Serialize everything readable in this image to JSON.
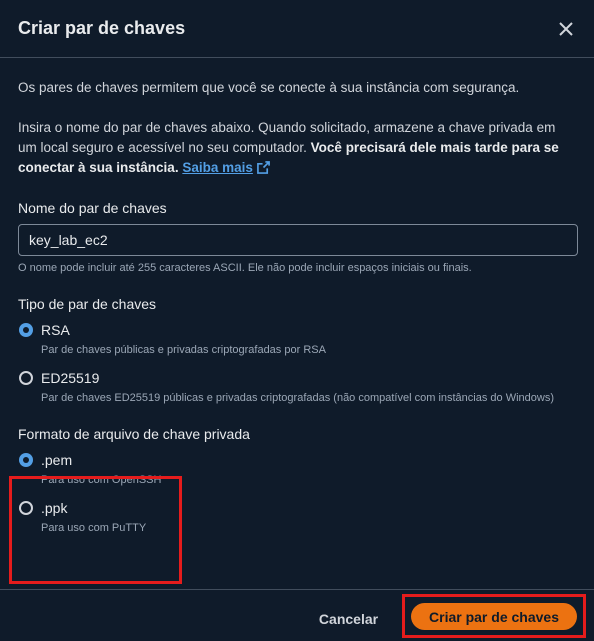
{
  "modal": {
    "title": "Criar par de chaves"
  },
  "intro": {
    "text": "Os pares de chaves permitem que você se conecte à sua instância com segurança.",
    "part1": "Insira o nome do par de chaves abaixo. Quando solicitado, armazene a chave privada em um local seguro e acessível no seu computador. ",
    "part2_bold": "Você precisará dele mais tarde para se conectar à sua instância.",
    "link": "Saiba mais"
  },
  "key_name": {
    "label": "Nome do par de chaves",
    "value": "key_lab_ec2",
    "hint": "O nome pode incluir até 255 caracteres ASCII. Ele não pode incluir espaços iniciais ou finais."
  },
  "key_type": {
    "label": "Tipo de par de chaves",
    "options": [
      {
        "label": "RSA",
        "description": "Par de chaves públicas e privadas criptografadas por RSA",
        "selected": true
      },
      {
        "label": "ED25519",
        "description": "Par de chaves ED25519 públicas e privadas criptografadas (não compatível com instâncias do Windows)",
        "selected": false
      }
    ]
  },
  "file_format": {
    "label": "Formato de arquivo de chave privada",
    "options": [
      {
        "label": ".pem",
        "description": "Para uso com OpenSSH",
        "selected": true
      },
      {
        "label": ".ppk",
        "description": "Para uso com PuTTY",
        "selected": false
      }
    ]
  },
  "footer": {
    "cancel_label": "Cancelar",
    "create_label": "Criar par de chaves"
  },
  "colors": {
    "background": "#0f1b2a",
    "accent": "#539fe5",
    "primary": "#ec7211",
    "highlight": "#e51c1c"
  }
}
